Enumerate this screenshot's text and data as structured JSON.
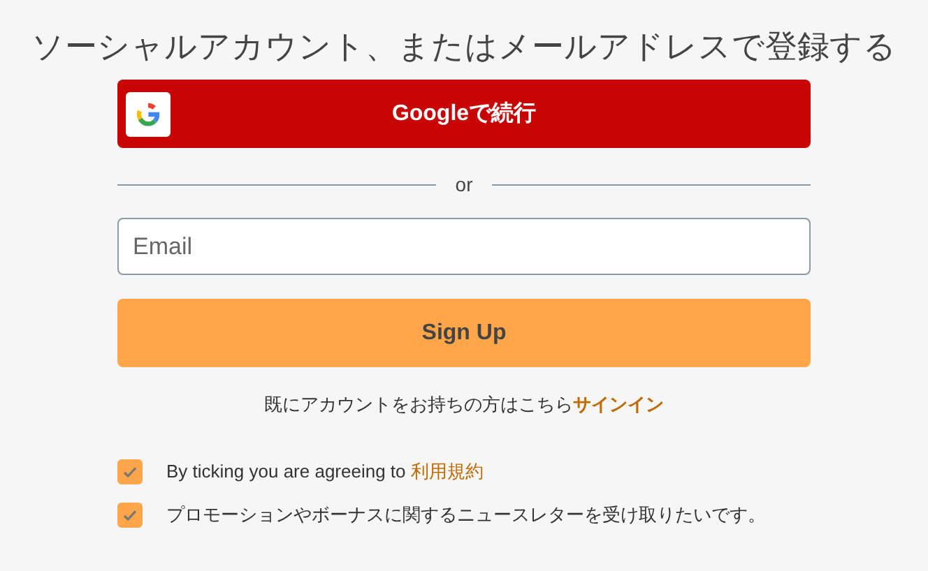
{
  "heading": "ソーシャルアカウント、またはメールアドレスで登録する",
  "google_button": {
    "label": "Googleで続行"
  },
  "divider": {
    "label": "or"
  },
  "email_field": {
    "placeholder": "Email"
  },
  "signup_button": {
    "label": "Sign Up"
  },
  "signin_prompt": {
    "text": "既にアカウントをお持ちの方はこちら",
    "link": "サインイン"
  },
  "checkboxes": [
    {
      "text": "By ticking you are agreeing to ",
      "link": "利用規約",
      "checked": true
    },
    {
      "text": "プロモーションやボーナスに関するニュースレターを受け取りたいです。",
      "checked": true
    }
  ]
}
